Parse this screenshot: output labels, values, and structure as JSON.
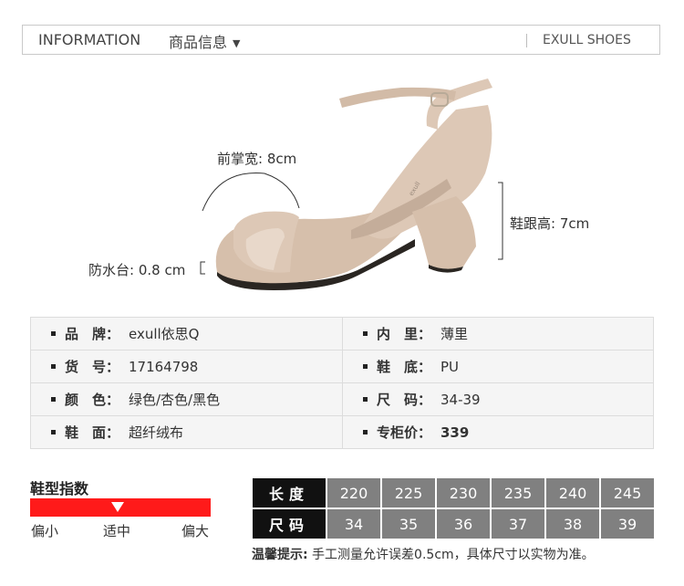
{
  "header": {
    "title_en": "INFORMATION",
    "title_cn": "商品信息",
    "dropdown_glyph": "▼",
    "brand": "EXULL SHOES"
  },
  "product_image": {
    "icon": "sandal-photo",
    "colors": {
      "suede": "#ddc8b6",
      "sole": "#2a2622",
      "strap_shadow": "#c4ad9a"
    },
    "labels": {
      "forefoot_width": "前掌宽: 8cm",
      "platform": "防水台: 0.8 cm",
      "heel_height": "鞋跟高: 7cm"
    }
  },
  "specs": {
    "rows": [
      [
        {
          "key": "品　牌：",
          "value": "exull依思Q"
        },
        {
          "key": "内　里：",
          "value": "薄里"
        }
      ],
      [
        {
          "key": "货　号：",
          "value": "17164798"
        },
        {
          "key": "鞋　底：",
          "value": "PU"
        }
      ],
      [
        {
          "key": "颜　色：",
          "value": "绿色/杏色/黑色"
        },
        {
          "key": "尺　码：",
          "value": "34-39"
        }
      ],
      [
        {
          "key": "鞋　面：",
          "value": "超纤绒布"
        },
        {
          "key": "专柜价：",
          "value": "339"
        }
      ]
    ]
  },
  "fit_index": {
    "title": "鞋型指数",
    "labels": [
      "偏小",
      "适中",
      "偏大"
    ],
    "marker_position": "适中",
    "bar_color": "#ff1a1a"
  },
  "size_chart": {
    "length_header": "长度",
    "size_header": "尺码",
    "lengths": [
      "220",
      "225",
      "230",
      "235",
      "240",
      "245"
    ],
    "sizes": [
      "34",
      "35",
      "36",
      "37",
      "38",
      "39"
    ]
  },
  "note": {
    "prefix": "温馨提示:",
    "text": " 手工测量允许误差0.5cm，具体尺寸以实物为准。"
  }
}
